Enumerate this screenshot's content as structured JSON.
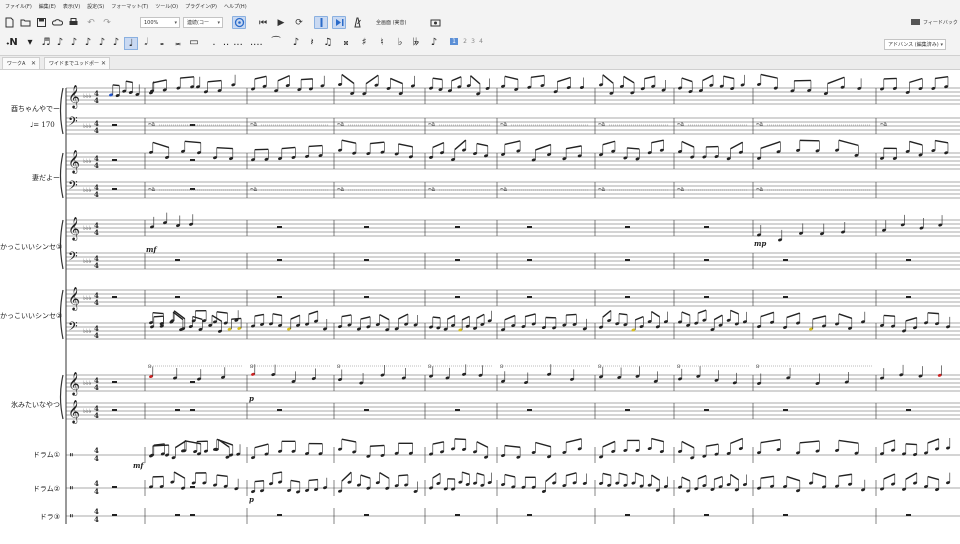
{
  "menu": [
    "ファイル(F)",
    "編集(E)",
    "表示(V)",
    "設定(S)",
    "フォーマット(T)",
    "ツール(O)",
    "プラグイン(P)",
    "ヘルプ(H)"
  ],
  "toolbar": {
    "zoom": "100%",
    "page_view": "連続(コー",
    "concert_pitch": "全画面 (実音)",
    "feedback": "フィードバック"
  },
  "palette": {
    "workspace": "アドバンス (編集済み)",
    "voices": [
      "1",
      "2",
      "3",
      "4"
    ]
  },
  "tabs": [
    {
      "label": "ワークA"
    },
    {
      "label": "ワイドまでユッドポー"
    }
  ],
  "score": {
    "tempo": "♩= 170",
    "instruments": [
      "酉ちゃんやでー",
      "妻だよー",
      "かっこいいシンセ①",
      "かっこいいシンセ②",
      "氷みたいなやつ",
      "ドラム①",
      "ドラム②",
      "ドラ③"
    ],
    "dynamics": {
      "mf": "mf",
      "p": "p",
      "mp": "mp"
    }
  },
  "colors": {
    "toolbar_bg": "#f3f3f3",
    "accent": "#2a6bc9",
    "note_red": "#cc2222",
    "note_yellow": "#d8c020",
    "note_blue": "#2255cc"
  }
}
